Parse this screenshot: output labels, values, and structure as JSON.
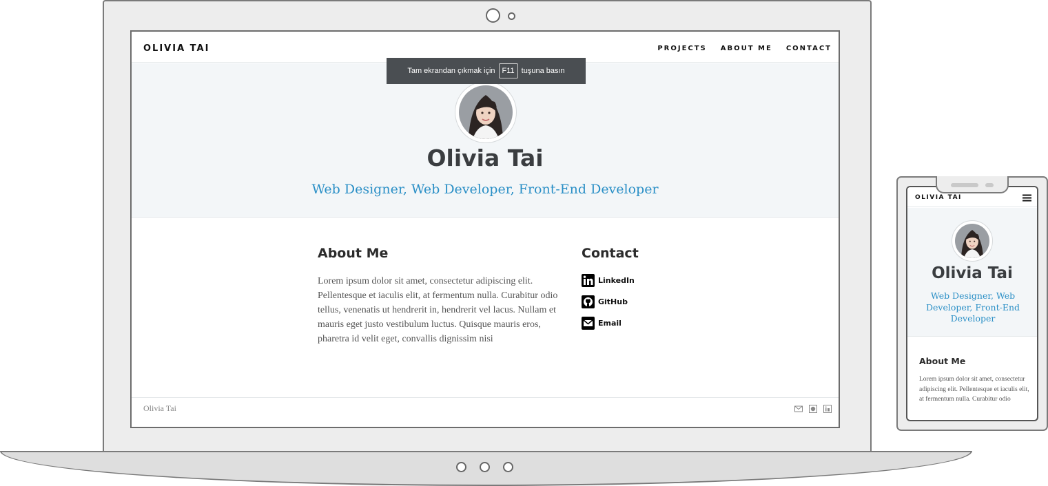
{
  "site": {
    "brand": "OLIVIA TAI",
    "nav": [
      {
        "label": "PROJECTS"
      },
      {
        "label": "ABOUT ME"
      },
      {
        "label": "CONTACT"
      }
    ],
    "fullscreen_toast": {
      "before": "Tam ekrandan çıkmak için",
      "key": "F11",
      "after": "tuşuna basın"
    },
    "hero": {
      "name": "Olivia Tai",
      "subtitle": "Web Designer, Web Developer, Front-End Developer",
      "subtitle_mobile": "Web Designer, Web Developer, Front-End Developer"
    },
    "about": {
      "heading": "About Me",
      "text": "Lorem ipsum dolor sit amet, consectetur adipiscing elit. Pellentesque et iaculis elit, at fermentum nulla. Curabitur odio tellus, venenatis ut hendrerit in, hendrerit vel lacus. Nullam et mauris eget justo vestibulum luctus. Quisque mauris eros, pharetra id velit eget, convallis dignissim nisi",
      "text_mobile": "Lorem ipsum dolor sit amet, consectetur adipiscing elit. Pellentesque et iaculis elit, at fermentum nulla. Curabitur odio"
    },
    "contact": {
      "heading": "Contact",
      "items": [
        {
          "label": "LinkedIn",
          "icon": "linkedin-icon"
        },
        {
          "label": "GitHub",
          "icon": "github-icon"
        },
        {
          "label": "Email",
          "icon": "email-icon"
        }
      ]
    },
    "footer": {
      "name": "Olivia Tai",
      "icons": [
        "email-icon",
        "github-icon",
        "linkedin-icon"
      ]
    }
  },
  "colors": {
    "accent": "#2a8fc6",
    "hero_bg": "#f3f6f8",
    "heading": "#3a3d40",
    "toast_bg": "#4a4e52"
  }
}
